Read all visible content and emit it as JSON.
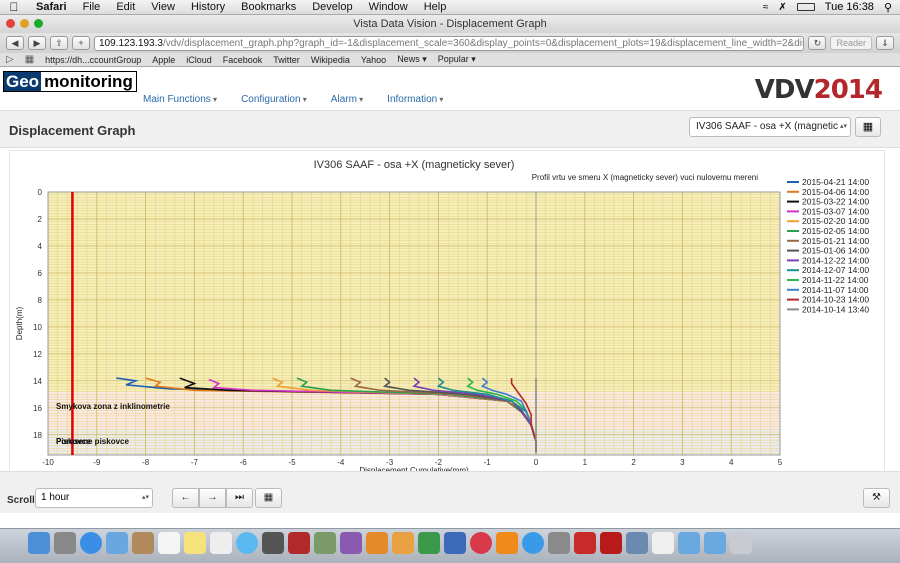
{
  "menubar": {
    "app": "Safari",
    "items": [
      "File",
      "Edit",
      "View",
      "History",
      "Bookmarks",
      "Develop",
      "Window",
      "Help"
    ],
    "clock": "Tue 16:38"
  },
  "browser": {
    "window_title": "Vista Data Vision - Displacement Graph",
    "url_host": "109.123.193.3",
    "url_path": "/vdv/displacement_graph.php?graph_id=-1&displacement_scale=360&display_points=0&displacement_plots=19&displacement_line_width=2&displacer",
    "reader": "Reader",
    "bookmarks": [
      "https://dh...ccountGroup",
      "Apple",
      "iCloud",
      "Facebook",
      "Twitter",
      "Wikipedia",
      "Yahoo",
      "News ▾",
      "Popular ▾"
    ]
  },
  "app": {
    "logo_part1": "Geo",
    "logo_part2": "monitoring",
    "nav": [
      "Main Functions",
      "Configuration",
      "Alarm",
      "Information"
    ],
    "brand_a": "VDV",
    "brand_b": "2014",
    "page_title": "Displacement Graph",
    "graph_select": "IV306 SAAF - osa +X (magnetic",
    "scroll_label": "Scroll",
    "scroll_value": "1 hour"
  },
  "chart_data": {
    "type": "line",
    "title": "IV306 SAAF - osa +X (magneticky sever)",
    "subtitle": "Profil vrtu ve smeru X (magneticky sever) vuci nulovemu mereni",
    "xlabel": "Displacement Cumulative(mm)",
    "ylabel": "Depth(m)",
    "xlim": [
      -10,
      5
    ],
    "ylim": [
      0,
      19.5
    ],
    "y_inverted": true,
    "xticks": [
      -10,
      -9,
      -8,
      -7,
      -6,
      -5,
      -4,
      -3,
      -2,
      -1,
      0,
      1,
      2,
      3,
      4,
      5
    ],
    "yticks": [
      0,
      2,
      4,
      6,
      8,
      10,
      12,
      14,
      16,
      18
    ],
    "legend_position": "right",
    "reference_x": -9.5,
    "zones": [
      {
        "label": "Porusene piskovce",
        "from": 0,
        "to": 14.8,
        "color": "#f7efb8"
      },
      {
        "label": "Smykova zona z inklinometrie",
        "from": 14.8,
        "to": 17.6,
        "color": "#fbe9e2"
      },
      {
        "label": "Piskovce",
        "from": 17.6,
        "to": 19.5,
        "color": "#ededed"
      }
    ],
    "series": [
      {
        "name": "2015-04-21 14:00",
        "color": "#1f5fb4",
        "points": [
          [
            -8.6,
            13.8
          ],
          [
            -8.2,
            14.0
          ],
          [
            -8.4,
            14.3
          ],
          [
            -7.5,
            14.6
          ],
          [
            -2.0,
            15.0
          ],
          [
            -0.6,
            15.5
          ],
          [
            -0.3,
            16.2
          ],
          [
            -0.1,
            17.2
          ],
          [
            0.0,
            18.5
          ],
          [
            0.0,
            19.3
          ]
        ]
      },
      {
        "name": "2015-04-06 14:00",
        "color": "#e07a1f",
        "points": [
          [
            -8.0,
            13.8
          ],
          [
            -7.7,
            14.1
          ],
          [
            -7.8,
            14.4
          ],
          [
            -7.0,
            14.7
          ],
          [
            -2.0,
            15.0
          ],
          [
            -0.6,
            15.5
          ],
          [
            -0.3,
            16.3
          ],
          [
            -0.1,
            17.2
          ],
          [
            0.0,
            18.5
          ],
          [
            0.0,
            19.3
          ]
        ]
      },
      {
        "name": "2015-03-22 14:00",
        "color": "#111111",
        "points": [
          [
            -7.3,
            13.8
          ],
          [
            -7.0,
            14.2
          ],
          [
            -7.2,
            14.5
          ],
          [
            -6.3,
            14.7
          ],
          [
            -2.0,
            15.0
          ],
          [
            -0.6,
            15.5
          ],
          [
            -0.3,
            16.2
          ],
          [
            -0.1,
            17.2
          ],
          [
            0.0,
            18.5
          ],
          [
            0.0,
            19.3
          ]
        ]
      },
      {
        "name": "2015-03-07 14:00",
        "color": "#d433c8",
        "points": [
          [
            -6.7,
            13.9
          ],
          [
            -6.5,
            14.2
          ],
          [
            -6.6,
            14.5
          ],
          [
            -5.8,
            14.7
          ],
          [
            -2.0,
            15.0
          ],
          [
            -0.6,
            15.5
          ],
          [
            -0.3,
            16.3
          ],
          [
            -0.1,
            17.3
          ],
          [
            0.0,
            18.5
          ],
          [
            0.0,
            19.3
          ]
        ]
      },
      {
        "name": "2015-02-20 14:00",
        "color": "#f0a030",
        "points": [
          [
            -5.4,
            13.8
          ],
          [
            -5.2,
            14.1
          ],
          [
            -5.3,
            14.4
          ],
          [
            -4.6,
            14.7
          ],
          [
            -1.9,
            15.0
          ],
          [
            -0.6,
            15.5
          ],
          [
            -0.3,
            16.2
          ],
          [
            -0.1,
            17.2
          ],
          [
            0.0,
            18.5
          ],
          [
            0.0,
            19.3
          ]
        ]
      },
      {
        "name": "2015-02-05 14:00",
        "color": "#2aa050",
        "points": [
          [
            -4.9,
            13.8
          ],
          [
            -4.7,
            14.1
          ],
          [
            -4.8,
            14.4
          ],
          [
            -4.2,
            14.7
          ],
          [
            -1.8,
            15.0
          ],
          [
            -0.6,
            15.5
          ],
          [
            -0.3,
            16.3
          ],
          [
            -0.1,
            17.3
          ],
          [
            0.0,
            18.5
          ],
          [
            0.0,
            19.3
          ]
        ]
      },
      {
        "name": "2015-01-21 14:00",
        "color": "#9a6a48",
        "points": [
          [
            -3.8,
            13.8
          ],
          [
            -3.6,
            14.1
          ],
          [
            -3.7,
            14.4
          ],
          [
            -3.2,
            14.7
          ],
          [
            -1.6,
            15.0
          ],
          [
            -0.6,
            15.5
          ],
          [
            -0.3,
            16.2
          ],
          [
            -0.1,
            17.2
          ],
          [
            0.0,
            18.5
          ],
          [
            0.0,
            19.3
          ]
        ]
      },
      {
        "name": "2015-01-06 14:00",
        "color": "#555555",
        "points": [
          [
            -3.1,
            13.8
          ],
          [
            -3.0,
            14.1
          ],
          [
            -3.1,
            14.4
          ],
          [
            -2.6,
            14.7
          ],
          [
            -1.4,
            15.0
          ],
          [
            -0.5,
            15.5
          ],
          [
            -0.3,
            16.3
          ],
          [
            -0.1,
            17.2
          ],
          [
            0.0,
            18.5
          ],
          [
            0.0,
            19.3
          ]
        ]
      },
      {
        "name": "2014-12-22 14:00",
        "color": "#7a3fb0",
        "points": [
          [
            -2.5,
            13.8
          ],
          [
            -2.4,
            14.1
          ],
          [
            -2.5,
            14.4
          ],
          [
            -2.1,
            14.7
          ],
          [
            -1.2,
            15.0
          ],
          [
            -0.5,
            15.5
          ],
          [
            -0.3,
            16.2
          ],
          [
            -0.1,
            17.3
          ],
          [
            0.0,
            18.5
          ],
          [
            0.0,
            19.3
          ]
        ]
      },
      {
        "name": "2014-12-07 14:00",
        "color": "#1a8f8f",
        "points": [
          [
            -2.0,
            13.8
          ],
          [
            -1.9,
            14.1
          ],
          [
            -2.0,
            14.4
          ],
          [
            -1.7,
            14.7
          ],
          [
            -1.0,
            15.0
          ],
          [
            -0.5,
            15.5
          ],
          [
            -0.2,
            16.3
          ],
          [
            -0.1,
            17.2
          ],
          [
            0.0,
            18.5
          ],
          [
            0.0,
            19.3
          ]
        ]
      },
      {
        "name": "2014-11-22 14:00",
        "color": "#27b84a",
        "points": [
          [
            -1.4,
            13.8
          ],
          [
            -1.3,
            14.1
          ],
          [
            -1.4,
            14.4
          ],
          [
            -1.2,
            14.7
          ],
          [
            -0.8,
            15.0
          ],
          [
            -0.4,
            15.5
          ],
          [
            -0.2,
            16.2
          ],
          [
            -0.1,
            17.2
          ],
          [
            0.0,
            18.5
          ],
          [
            0.0,
            19.3
          ]
        ]
      },
      {
        "name": "2014-11-07 14:00",
        "color": "#3a7fd0",
        "points": [
          [
            -1.1,
            13.8
          ],
          [
            -1.0,
            14.1
          ],
          [
            -1.1,
            14.4
          ],
          [
            -0.9,
            14.7
          ],
          [
            -0.6,
            15.0
          ],
          [
            -0.3,
            15.5
          ],
          [
            -0.2,
            16.3
          ],
          [
            -0.1,
            17.2
          ],
          [
            0.0,
            18.5
          ],
          [
            0.0,
            19.3
          ]
        ]
      },
      {
        "name": "2014-10-23 14:00",
        "color": "#b3262a",
        "points": [
          [
            -0.5,
            13.8
          ],
          [
            -0.5,
            14.2
          ],
          [
            -0.4,
            14.7
          ],
          [
            -0.3,
            15.2
          ],
          [
            -0.2,
            15.7
          ],
          [
            -0.1,
            16.5
          ],
          [
            -0.1,
            17.3
          ],
          [
            0.0,
            18.5
          ],
          [
            0.0,
            19.3
          ]
        ]
      },
      {
        "name": "2014-10-14 13:40",
        "color": "#8a8a8a",
        "points": [
          [
            0.0,
            13.8
          ],
          [
            0.0,
            15.0
          ],
          [
            0.0,
            16.5
          ],
          [
            0.0,
            18.0
          ],
          [
            0.0,
            19.3
          ]
        ]
      }
    ]
  }
}
